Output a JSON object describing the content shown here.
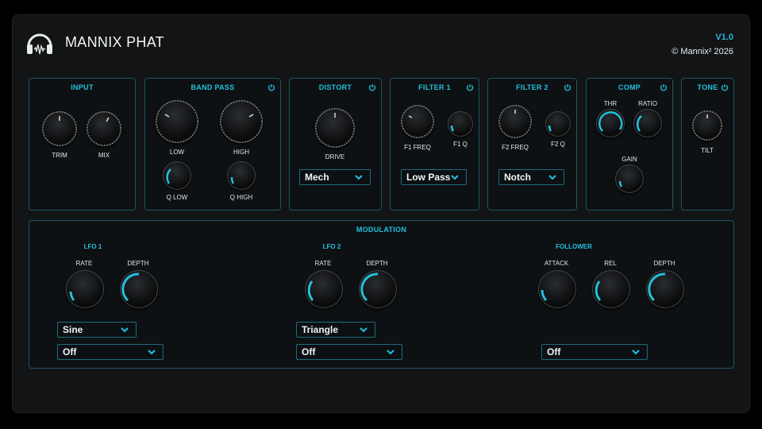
{
  "header": {
    "title": "MANNIX PHAT",
    "version": "V1.0",
    "copyright": "© Mannix² 2026"
  },
  "colors": {
    "accent": "#22c1dd",
    "border": "#1c5565",
    "panel_bg": "#0e1113"
  },
  "input": {
    "title": "INPUT",
    "trim_label": "TRIM",
    "mix_label": "MIX"
  },
  "band_pass": {
    "title": "BAND PASS",
    "low_label": "LOW",
    "high_label": "HIGH",
    "q_low_label": "Q LOW",
    "q_high_label": "Q HIGH"
  },
  "distort": {
    "title": "DISTORT",
    "drive_label": "DRIVE",
    "mode": "Mech"
  },
  "filter1": {
    "title": "FILTER 1",
    "freq_label": "F1 FREQ",
    "q_label": "F1 Q",
    "type": "Low Pass"
  },
  "filter2": {
    "title": "FILTER 2",
    "freq_label": "F2 FREQ",
    "q_label": "F2 Q",
    "type": "Notch"
  },
  "comp": {
    "title": "COMP",
    "thr_label": "THR",
    "ratio_label": "RATIO",
    "gain_label": "GAIN"
  },
  "tone": {
    "title": "TONE",
    "tilt_label": "TILT"
  },
  "modulation": {
    "title": "MODULATION",
    "lfo1": {
      "title": "LFO 1",
      "rate_label": "RATE",
      "depth_label": "DEPTH",
      "shape": "Sine",
      "target": "Off"
    },
    "lfo2": {
      "title": "LFO 2",
      "rate_label": "RATE",
      "depth_label": "DEPTH",
      "shape": "Triangle",
      "target": "Off"
    },
    "follower": {
      "title": "FOLLOWER",
      "attack_label": "ATTACK",
      "rel_label": "REL",
      "depth_label": "DEPTH",
      "target": "Off"
    }
  },
  "icons": {
    "logo": "headphones-logo-icon",
    "power": "power-icon",
    "dropdown": "chevron-down-icon"
  }
}
